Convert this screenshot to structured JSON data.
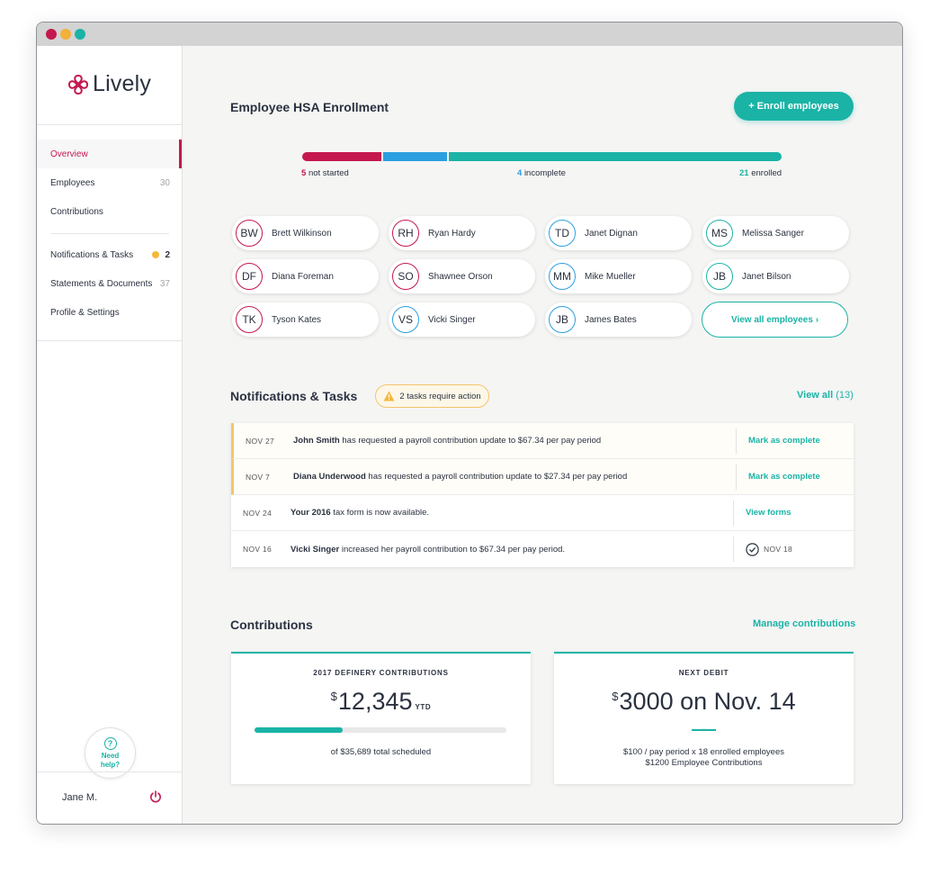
{
  "brand": {
    "name": "Lively"
  },
  "sidebar": {
    "items": [
      {
        "label": "Overview",
        "count": ""
      },
      {
        "label": "Employees",
        "count": "30"
      },
      {
        "label": "Contributions",
        "count": ""
      },
      {
        "label": "Notifications & Tasks",
        "count": "2"
      },
      {
        "label": "Statements & Documents",
        "count": "37"
      },
      {
        "label": "Profile & Settings",
        "count": ""
      }
    ],
    "help_label": "Need help?",
    "help_icon": "question-icon",
    "user_name": "Jane M."
  },
  "enrollment": {
    "title": "Employee HSA Enrollment",
    "enroll_button": "+ Enroll employees",
    "not_started_count": "5",
    "not_started_label": "not started",
    "incomplete_count": "4",
    "incomplete_label": "incomplete",
    "enrolled_count": "21",
    "enrolled_label": "enrolled",
    "progress_fractions": {
      "not_started": 0.1667,
      "incomplete": 0.1333,
      "enrolled": 0.7
    },
    "employees": [
      {
        "initials": "BW",
        "name": "Brett Wilkinson",
        "status": "not-started"
      },
      {
        "initials": "RH",
        "name": "Ryan Hardy",
        "status": "not-started"
      },
      {
        "initials": "TD",
        "name": "Janet Dignan",
        "status": "incomplete"
      },
      {
        "initials": "MS",
        "name": "Melissa Sanger",
        "status": "enrolled"
      },
      {
        "initials": "DF",
        "name": "Diana Foreman",
        "status": "not-started"
      },
      {
        "initials": "SO",
        "name": "Shawnee Orson",
        "status": "not-started"
      },
      {
        "initials": "MM",
        "name": "Mike Mueller",
        "status": "incomplete"
      },
      {
        "initials": "JB",
        "name": "Janet Bilson",
        "status": "enrolled"
      },
      {
        "initials": "TK",
        "name": "Tyson Kates",
        "status": "not-started"
      },
      {
        "initials": "VS",
        "name": "Vicki Singer",
        "status": "incomplete"
      },
      {
        "initials": "JB",
        "name": "James Bates",
        "status": "incomplete"
      }
    ],
    "view_all_employees": "View all employees ›"
  },
  "notifications": {
    "title": "Notifications & Tasks",
    "badge": "2 tasks require action",
    "view_all": "View all",
    "view_all_count": "(13)",
    "rows": [
      {
        "date": "NOV 27",
        "bold": "John Smith",
        "text": " has requested a payroll contribution update to $67.34 per pay period",
        "action": "Mark as complete"
      },
      {
        "date": "NOV 7",
        "bold": "Diana Underwood",
        "text": " has requested a payroll contribution update to $27.34 per pay period",
        "action": "Mark as complete"
      },
      {
        "date": "NOV 24",
        "bold": "Your 2016",
        "text": " tax form is now available.",
        "action": "View forms"
      },
      {
        "date": "NOV 16",
        "bold": "Vicki Singer",
        "text": " increased her payroll contribution to $67.34 per pay period.",
        "done_date": "NOV 18"
      }
    ]
  },
  "contributions": {
    "title": "Contributions",
    "manage_link": "Manage contributions",
    "card1": {
      "label": "2017 DEFINERY CONTRIBUTIONS",
      "currency": "$",
      "amount": "12,345",
      "suffix": "YTD",
      "progress": 0.35,
      "sub": "of $35,689 total scheduled"
    },
    "card2": {
      "label": "NEXT DEBIT",
      "currency": "$",
      "amount": "3000 on Nov. 14",
      "line1": "$100 / pay period x 18 enrolled employees",
      "line2": "$1200 Employee Contributions"
    }
  },
  "colors": {
    "accent_teal": "#1ab3a6",
    "brand_red": "#c4184f",
    "incomplete_blue": "#2b9fe0",
    "warning_yellow": "#f5b83c"
  }
}
